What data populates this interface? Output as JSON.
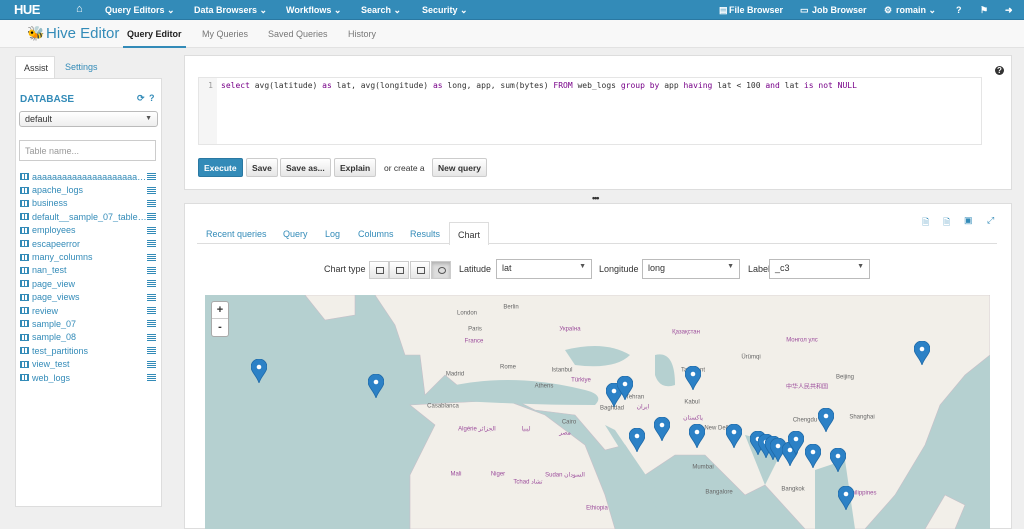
{
  "topnav": {
    "logo": "HUE",
    "items": [
      "Query Editors ⌄",
      "Data Browsers ⌄",
      "Workflows ⌄",
      "Search ⌄",
      "Security ⌄"
    ],
    "file_browser": "File Browser",
    "job_browser": "Job Browser",
    "user": "romain ⌄"
  },
  "subnav": {
    "app_title": "Hive Editor",
    "tabs": [
      "Query Editor",
      "My Queries",
      "Saved Queries",
      "History"
    ],
    "active_tab": "Query Editor"
  },
  "assist": {
    "tabs": [
      "Assist",
      "Settings"
    ],
    "database_label": "DATABASE",
    "database_selected": "default",
    "table_placeholder": "Table name...",
    "tables": [
      "aaaaaaaaaaaaaaaaaaaaaaaaaaa",
      "apache_logs",
      "business",
      "default__sample_07_table__",
      "employees",
      "escapeerror",
      "many_columns",
      "nan_test",
      "page_view",
      "page_views",
      "review",
      "sample_07",
      "sample_08",
      "test_partitions",
      "view_test",
      "web_logs"
    ]
  },
  "editor": {
    "line_number": "1",
    "query": "select avg(latitude) as lat, avg(longitude) as long, app, sum(bytes) FROM web_logs group by app having lat < 100 and lat is not NULL",
    "buttons": {
      "execute": "Execute",
      "save": "Save",
      "save_as": "Save as...",
      "explain": "Explain",
      "or_create": "or create a",
      "new_query": "New query"
    }
  },
  "results": {
    "tabs": [
      "Recent queries",
      "Query",
      "Log",
      "Columns",
      "Results",
      "Chart"
    ],
    "active_tab": "Chart",
    "chart_type_label": "Chart type",
    "chart_types": [
      "bar-chart-icon",
      "line-chart-icon",
      "pie-chart-icon",
      "map-icon"
    ],
    "chart_type_selected": "map-icon",
    "latitude_label": "Latitude",
    "latitude_value": "lat",
    "longitude_label": "Longitude",
    "longitude_value": "long",
    "label_label": "Label",
    "label_value": "_c3"
  },
  "map": {
    "zoom_in": "+",
    "zoom_out": "-",
    "labels": [
      "France",
      "Україна",
      "Қазақстан",
      "Монгол улс",
      "Türkiye",
      "Tehran",
      "Baghdad",
      "Cairo",
      "Algérie الجزائر",
      "ليبيا",
      "مصر",
      "Mali",
      "Niger",
      "Tchad تشاد",
      "Sudan السودان",
      "Ethiopia",
      "中华人民共和国",
      "Beijing",
      "Paris",
      "London",
      "Berlin",
      "Madrid",
      "Rome",
      "Kabul",
      "New Delhi",
      "Mumbai",
      "Bangalore",
      "Bangkok",
      "Shanghai",
      "Chengdu",
      "Philippines",
      "Ürümqi",
      "Tashkent",
      "Istanbul",
      "Athens",
      "Casablanca",
      "پاکستان",
      "ایران"
    ],
    "marker_color": "#2c81c6"
  },
  "colors": {
    "brand": "#338bb8",
    "water": "#b5d0d0",
    "land": "#f2efe9"
  }
}
